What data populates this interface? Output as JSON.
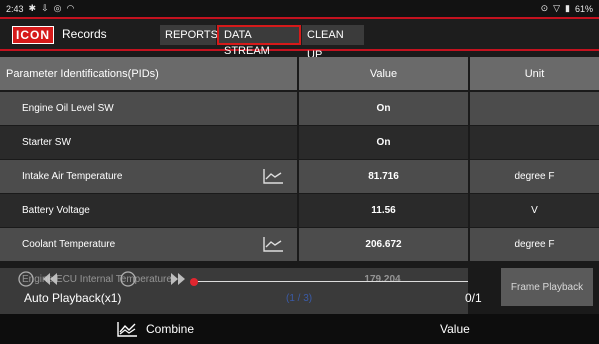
{
  "status_bar": {
    "time": "2:43",
    "battery": "61%"
  },
  "header": {
    "logo_text": "ICON",
    "title": "Records",
    "tabs": [
      "REPORTS",
      "DATA STREAM",
      "CLEAN UP"
    ],
    "active_tab": "DATA STREAM",
    "accent_color": "#d61a1a"
  },
  "table": {
    "columns": [
      "Parameter Identifications(PIDs)",
      "Value",
      "Unit"
    ],
    "rows": [
      {
        "name": "Engine Oil Level SW",
        "value": "On",
        "unit": "",
        "graph": false
      },
      {
        "name": "Starter SW",
        "value": "On",
        "unit": "",
        "graph": false
      },
      {
        "name": "Intake Air Temperature",
        "value": "81.716",
        "unit": "degree F",
        "graph": true
      },
      {
        "name": "Battery Voltage",
        "value": "11.56",
        "unit": "V",
        "graph": false
      },
      {
        "name": "Coolant Temperature",
        "value": "206.672",
        "unit": "degree F",
        "graph": true
      },
      {
        "name": "Engine ECU Internal Temperature",
        "value": "179.204",
        "unit": "",
        "graph": false
      }
    ]
  },
  "playback": {
    "mode_label": "Auto Playback(x1)",
    "page_indicator": "(1 / 3)",
    "frame_counter": "0/1",
    "frame_button": "Frame Playback"
  },
  "footer": {
    "combine_label": "Combine",
    "value_label": "Value"
  }
}
